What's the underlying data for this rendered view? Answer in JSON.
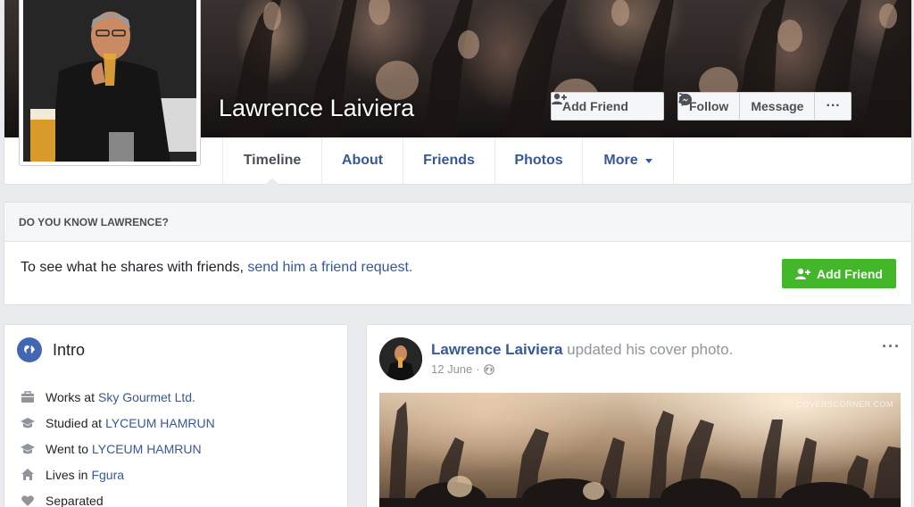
{
  "cover": {
    "name": "Lawrence Laiviera",
    "add_friend_label": "Add Friend",
    "follow_label": "Follow",
    "message_label": "Message",
    "more_dots": "···"
  },
  "tabs": [
    {
      "label": "Timeline"
    },
    {
      "label": "About"
    },
    {
      "label": "Friends"
    },
    {
      "label": "Photos"
    },
    {
      "label": "More"
    }
  ],
  "know": {
    "heading": "DO YOU KNOW LAWRENCE?",
    "text": "To see what he shares with friends, ",
    "link": "send him a friend request.",
    "button_label": "Add Friend"
  },
  "intro": {
    "title": "Intro",
    "items": [
      {
        "prefix": "Works at",
        "link": "Sky Gourmet Ltd.",
        "icon": "briefcase-icon"
      },
      {
        "prefix": "Studied at",
        "link": "LYCEUM HAMRUN",
        "icon": "graduation-cap-icon"
      },
      {
        "prefix": "Went to",
        "link": "LYCEUM HAMRUN",
        "icon": "graduation-cap-icon"
      },
      {
        "prefix": "Lives in",
        "link": "Fgura",
        "icon": "home-icon"
      },
      {
        "prefix": "Separated",
        "link": "",
        "icon": "heart-icon"
      }
    ]
  },
  "post": {
    "author": "Lawrence Laiviera",
    "action": " updated his cover photo.",
    "date": "12 June",
    "separator": "·",
    "dots": "···",
    "watermark": "COVERSCORNER.COM"
  },
  "colors": {
    "link": "#365899",
    "green": "#42b72a",
    "background": "#e9ebee"
  }
}
